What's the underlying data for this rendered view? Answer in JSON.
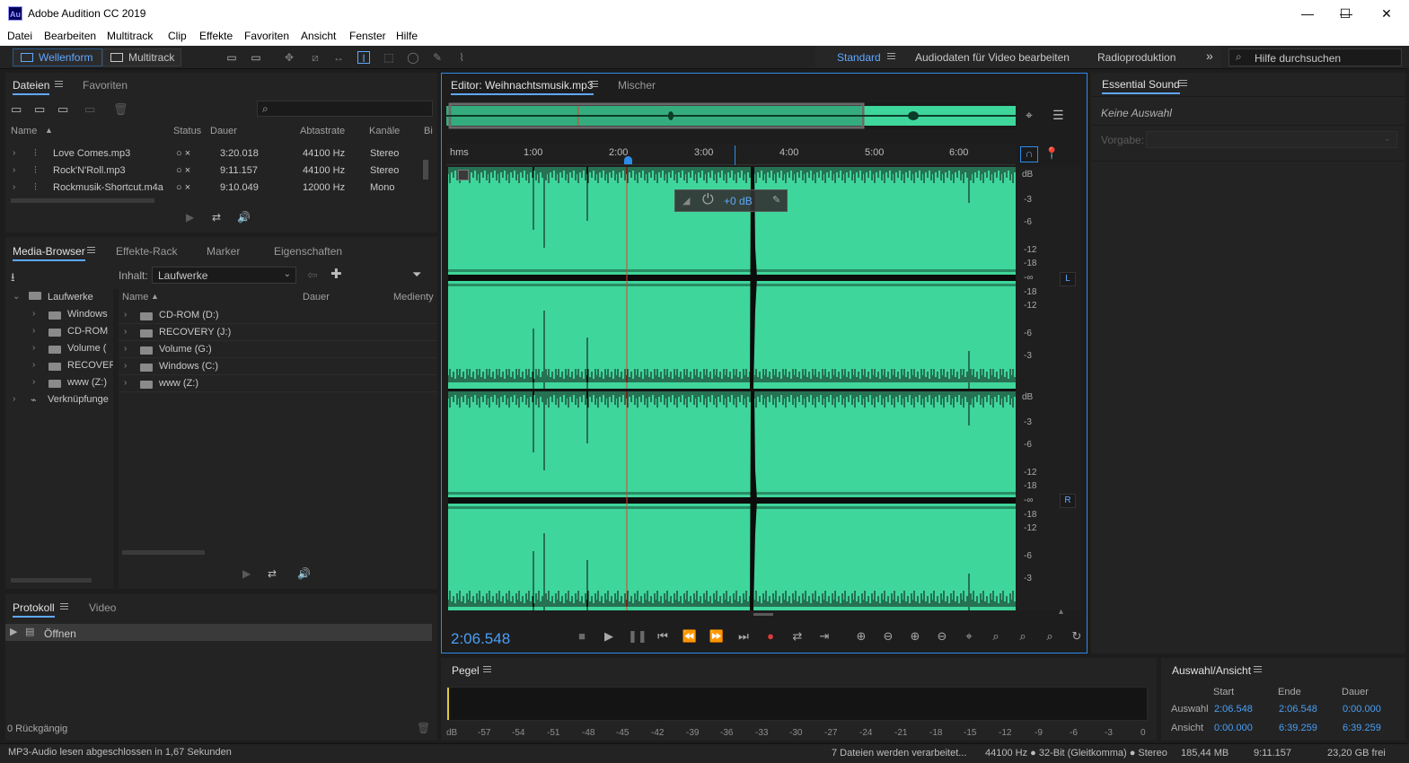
{
  "window": {
    "title": "Adobe Audition CC 2019",
    "logo_text": "Au",
    "controls": [
      "—",
      "☐",
      "✕"
    ]
  },
  "menu": [
    "Datei",
    "Bearbeiten",
    "Multitrack",
    "Clip",
    "Effekte",
    "Favoriten",
    "Ansicht",
    "Fenster",
    "Hilfe"
  ],
  "toolbar": {
    "mode_waveform": "Wellenform",
    "mode_multitrack": "Multitrack",
    "workspaces": [
      "Standard",
      "Audiodaten für Video bearbeiten",
      "Radioproduktion"
    ],
    "overflow": "»",
    "search_placeholder": "Hilfe durchsuchen"
  },
  "files_panel": {
    "tabs": [
      "Dateien",
      "Favoriten"
    ],
    "columns": [
      "Name",
      "Status",
      "Dauer",
      "Abtastrate",
      "Kanäle",
      "Bi"
    ],
    "rows": [
      {
        "name": "Love Comes.mp3",
        "duration": "3:20.018",
        "rate": "44100 Hz",
        "channels": "Stereo"
      },
      {
        "name": "Rock'N'Roll.mp3",
        "duration": "9:11.157",
        "rate": "44100 Hz",
        "channels": "Stereo"
      },
      {
        "name": "Rockmusik-Shortcut.m4a",
        "duration": "9:10.049",
        "rate": "12000 Hz",
        "channels": "Mono"
      }
    ]
  },
  "media_browser": {
    "tabs": [
      "Media-Browser",
      "Effekte-Rack",
      "Marker",
      "Eigenschaften"
    ],
    "content_label": "Inhalt:",
    "content_value": "Laufwerke",
    "tree": [
      "Laufwerke",
      "Windows",
      "CD-ROM",
      "Volume (",
      "RECOVER",
      "www (Z:)",
      "Verknüpfunge"
    ],
    "columns": [
      "Name",
      "Dauer",
      "Medienty"
    ],
    "rows": [
      "CD-ROM (D:)",
      "RECOVERY (J:)",
      "Volume (G:)",
      "Windows (C:)",
      "www (Z:)"
    ]
  },
  "history_panel": {
    "tabs": [
      "Protokoll",
      "Video"
    ],
    "items": [
      "Öffnen"
    ],
    "undo_count": "0 Rückgängig"
  },
  "editor": {
    "tabs": [
      "Editor: Weihnachtsmusik.mp3",
      "Mischer"
    ],
    "ruler_unit": "hms",
    "ruler_ticks": [
      "1:00",
      "2:00",
      "3:00",
      "4:00",
      "5:00",
      "6:00"
    ],
    "hud_gain": "+0 dB",
    "db_scale": [
      "dB",
      "-3",
      "-6",
      "-12",
      "-18",
      "-∞",
      "-18",
      "-12",
      "-6",
      "-3"
    ],
    "channel_left": "L",
    "channel_right": "R",
    "time_display": "2:06.548",
    "wave_color": "#3fd69b",
    "accent_color": "#2d8ceb"
  },
  "essential_sound": {
    "title": "Essential Sound",
    "no_selection": "Keine Auswahl",
    "preset_label": "Vorgabe:"
  },
  "level_panel": {
    "title": "Pegel",
    "scale": [
      "dB",
      "-57",
      "-54",
      "-51",
      "-48",
      "-45",
      "-42",
      "-39",
      "-36",
      "-33",
      "-30",
      "-27",
      "-24",
      "-21",
      "-18",
      "-15",
      "-12",
      "-9",
      "-6",
      "-3",
      "0"
    ]
  },
  "selection_view": {
    "title": "Auswahl/Ansicht",
    "headers": [
      "Start",
      "Ende",
      "Dauer"
    ],
    "rows": [
      {
        "label": "Auswahl",
        "start": "2:06.548",
        "end": "2:06.548",
        "duration": "0:00.000"
      },
      {
        "label": "Ansicht",
        "start": "0:00.000",
        "end": "6:39.259",
        "duration": "6:39.259"
      }
    ]
  },
  "statusbar": {
    "left": "MP3-Audio lesen abgeschlossen in 1,67 Sekunden",
    "processing": "7 Dateien werden verarbeitet...",
    "format": "44100 Hz ● 32-Bit (Gleitkomma) ● Stereo",
    "size": "185,44 MB",
    "duration": "9:11.157",
    "free": "23,20 GB frei"
  }
}
